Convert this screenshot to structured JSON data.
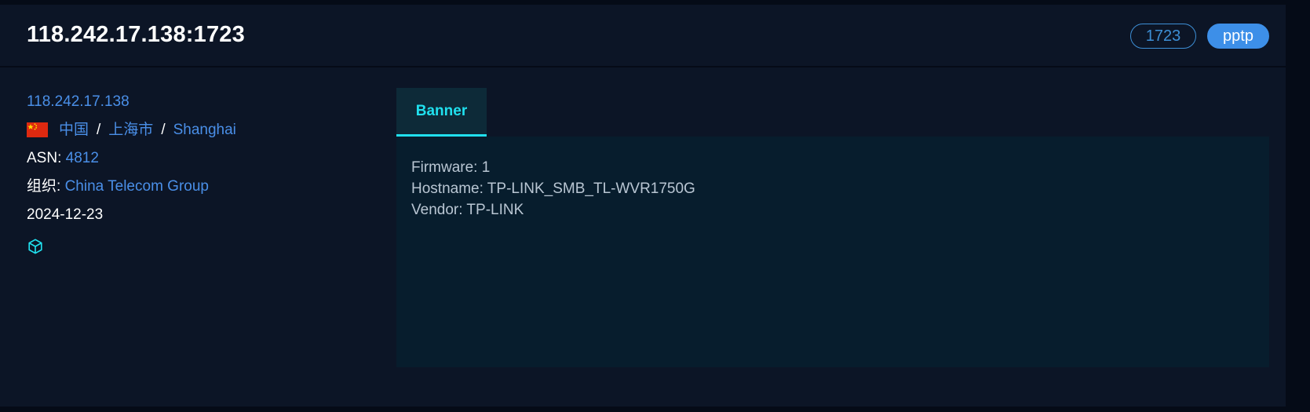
{
  "header": {
    "title": "118.242.17.138:1723",
    "port_tag": "1723",
    "protocol_tag": "pptp"
  },
  "info": {
    "ip": "118.242.17.138",
    "country": "中国",
    "region": "上海市",
    "city": "Shanghai",
    "asn_label": "ASN:",
    "asn_value": "4812",
    "org_label": "组织:",
    "org_value": "China Telecom Group",
    "date": "2024-12-23",
    "separator": "/"
  },
  "tabs": [
    {
      "label": "Banner",
      "active": true
    }
  ],
  "banner": {
    "lines": [
      "Firmware: 1",
      "Hostname: TP-LINK_SMB_TL-WVR1750G",
      "Vendor: TP-LINK"
    ]
  },
  "icons": {
    "flag": "china-flag-icon",
    "cube": "cube-icon"
  },
  "colors": {
    "background": "#050b17",
    "card": "#0c1526",
    "link": "#4a8fe8",
    "accent": "#20e0ee",
    "tag_fill": "#3d8fe8",
    "banner_bg": "#071d2d"
  }
}
